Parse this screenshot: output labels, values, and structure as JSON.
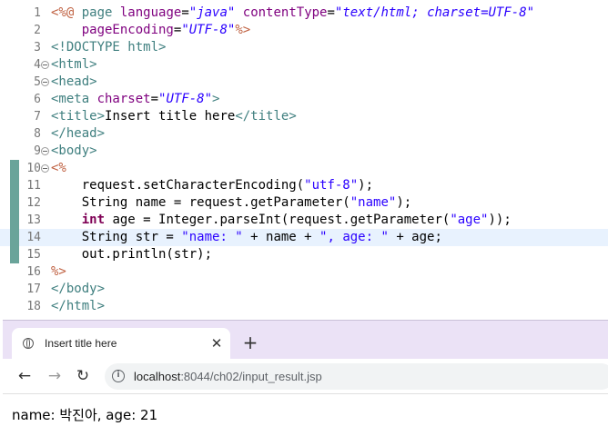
{
  "editor": {
    "lines": [
      {
        "num": "1",
        "fold": false,
        "segments": [
          {
            "c": "jsp",
            "t": "<%@ "
          },
          {
            "c": "kw",
            "t": "page "
          },
          {
            "c": "attr",
            "t": "language"
          },
          {
            "c": "",
            "t": "="
          },
          {
            "c": "str",
            "t": "\"java\""
          },
          {
            "c": "",
            "t": " "
          },
          {
            "c": "attr",
            "t": "contentType"
          },
          {
            "c": "",
            "t": "="
          },
          {
            "c": "str",
            "t": "\"text/html; charset=UTF-8\""
          }
        ]
      },
      {
        "num": "2",
        "fold": false,
        "segments": [
          {
            "c": "",
            "t": "    "
          },
          {
            "c": "attr",
            "t": "pageEncoding"
          },
          {
            "c": "",
            "t": "="
          },
          {
            "c": "str",
            "t": "\"UTF-8\""
          },
          {
            "c": "jsp",
            "t": "%>"
          }
        ]
      },
      {
        "num": "3",
        "fold": false,
        "segments": [
          {
            "c": "kw",
            "t": "<!DOCTYPE html>"
          }
        ]
      },
      {
        "num": "4",
        "fold": true,
        "segments": [
          {
            "c": "kw",
            "t": "<html>"
          }
        ]
      },
      {
        "num": "5",
        "fold": true,
        "segments": [
          {
            "c": "kw",
            "t": "<head>"
          }
        ]
      },
      {
        "num": "6",
        "fold": false,
        "segments": [
          {
            "c": "kw",
            "t": "<meta "
          },
          {
            "c": "attr",
            "t": "charset"
          },
          {
            "c": "",
            "t": "="
          },
          {
            "c": "str",
            "t": "\"UTF-8\""
          },
          {
            "c": "kw",
            "t": ">"
          }
        ]
      },
      {
        "num": "7",
        "fold": false,
        "segments": [
          {
            "c": "kw",
            "t": "<title>"
          },
          {
            "c": "",
            "t": "Insert title here"
          },
          {
            "c": "kw",
            "t": "</title>"
          }
        ]
      },
      {
        "num": "8",
        "fold": false,
        "segments": [
          {
            "c": "kw",
            "t": "</head>"
          }
        ]
      },
      {
        "num": "9",
        "fold": true,
        "segments": [
          {
            "c": "kw",
            "t": "<body>"
          }
        ]
      },
      {
        "num": "10",
        "fold": true,
        "mark": true,
        "segments": [
          {
            "c": "jsp",
            "t": "<%"
          }
        ]
      },
      {
        "num": "11",
        "fold": false,
        "mark": true,
        "segments": [
          {
            "c": "",
            "t": "    request.setCharacterEncoding("
          },
          {
            "c": "jstr",
            "t": "\"utf-8\""
          },
          {
            "c": "",
            "t": ");"
          }
        ]
      },
      {
        "num": "12",
        "fold": false,
        "mark": true,
        "segments": [
          {
            "c": "",
            "t": "    String name = request.getParameter("
          },
          {
            "c": "jstr",
            "t": "\"name\""
          },
          {
            "c": "",
            "t": ");"
          }
        ]
      },
      {
        "num": "13",
        "fold": false,
        "mark": true,
        "segments": [
          {
            "c": "",
            "t": "    "
          },
          {
            "c": "jkw",
            "t": "int"
          },
          {
            "c": "",
            "t": " age = Integer.parseInt(request.getParameter("
          },
          {
            "c": "jstr",
            "t": "\"age\""
          },
          {
            "c": "",
            "t": "));"
          }
        ]
      },
      {
        "num": "14",
        "fold": false,
        "mark": true,
        "current": true,
        "segments": [
          {
            "c": "",
            "t": "    String str = "
          },
          {
            "c": "jstr",
            "t": "\"name: \""
          },
          {
            "c": "",
            "t": " + name + "
          },
          {
            "c": "jstr",
            "t": "\", age: \""
          },
          {
            "c": "",
            "t": " + age;"
          }
        ]
      },
      {
        "num": "15",
        "fold": false,
        "mark": true,
        "segments": [
          {
            "c": "",
            "t": "    out.println(str);"
          }
        ]
      },
      {
        "num": "16",
        "fold": false,
        "segments": [
          {
            "c": "jsp",
            "t": "%>"
          }
        ]
      },
      {
        "num": "17",
        "fold": false,
        "segments": [
          {
            "c": "kw",
            "t": "</body>"
          }
        ]
      },
      {
        "num": "18",
        "fold": false,
        "segments": [
          {
            "c": "kw",
            "t": "</html>"
          }
        ]
      }
    ]
  },
  "browser": {
    "tab": {
      "title": "Insert title here",
      "favicon": "globe-icon",
      "close": "✕"
    },
    "new_tab": "+",
    "toolbar": {
      "back": "←",
      "forward": "→",
      "reload": "↻"
    },
    "address": {
      "host": "localhost",
      "rest": ":8044/ch02/input_result.jsp"
    },
    "page_output": "name: 박진아, age: 21"
  },
  "colors": {
    "jsp": "#bf5f3f",
    "tag": "#3f7f7f",
    "attr": "#7f007f",
    "string": "#2a00ff",
    "java_keyword": "#7f0055",
    "current_line": "#e8f2fe",
    "change_marker": "#6aa49a",
    "tab_strip": "#ebe2f6"
  }
}
